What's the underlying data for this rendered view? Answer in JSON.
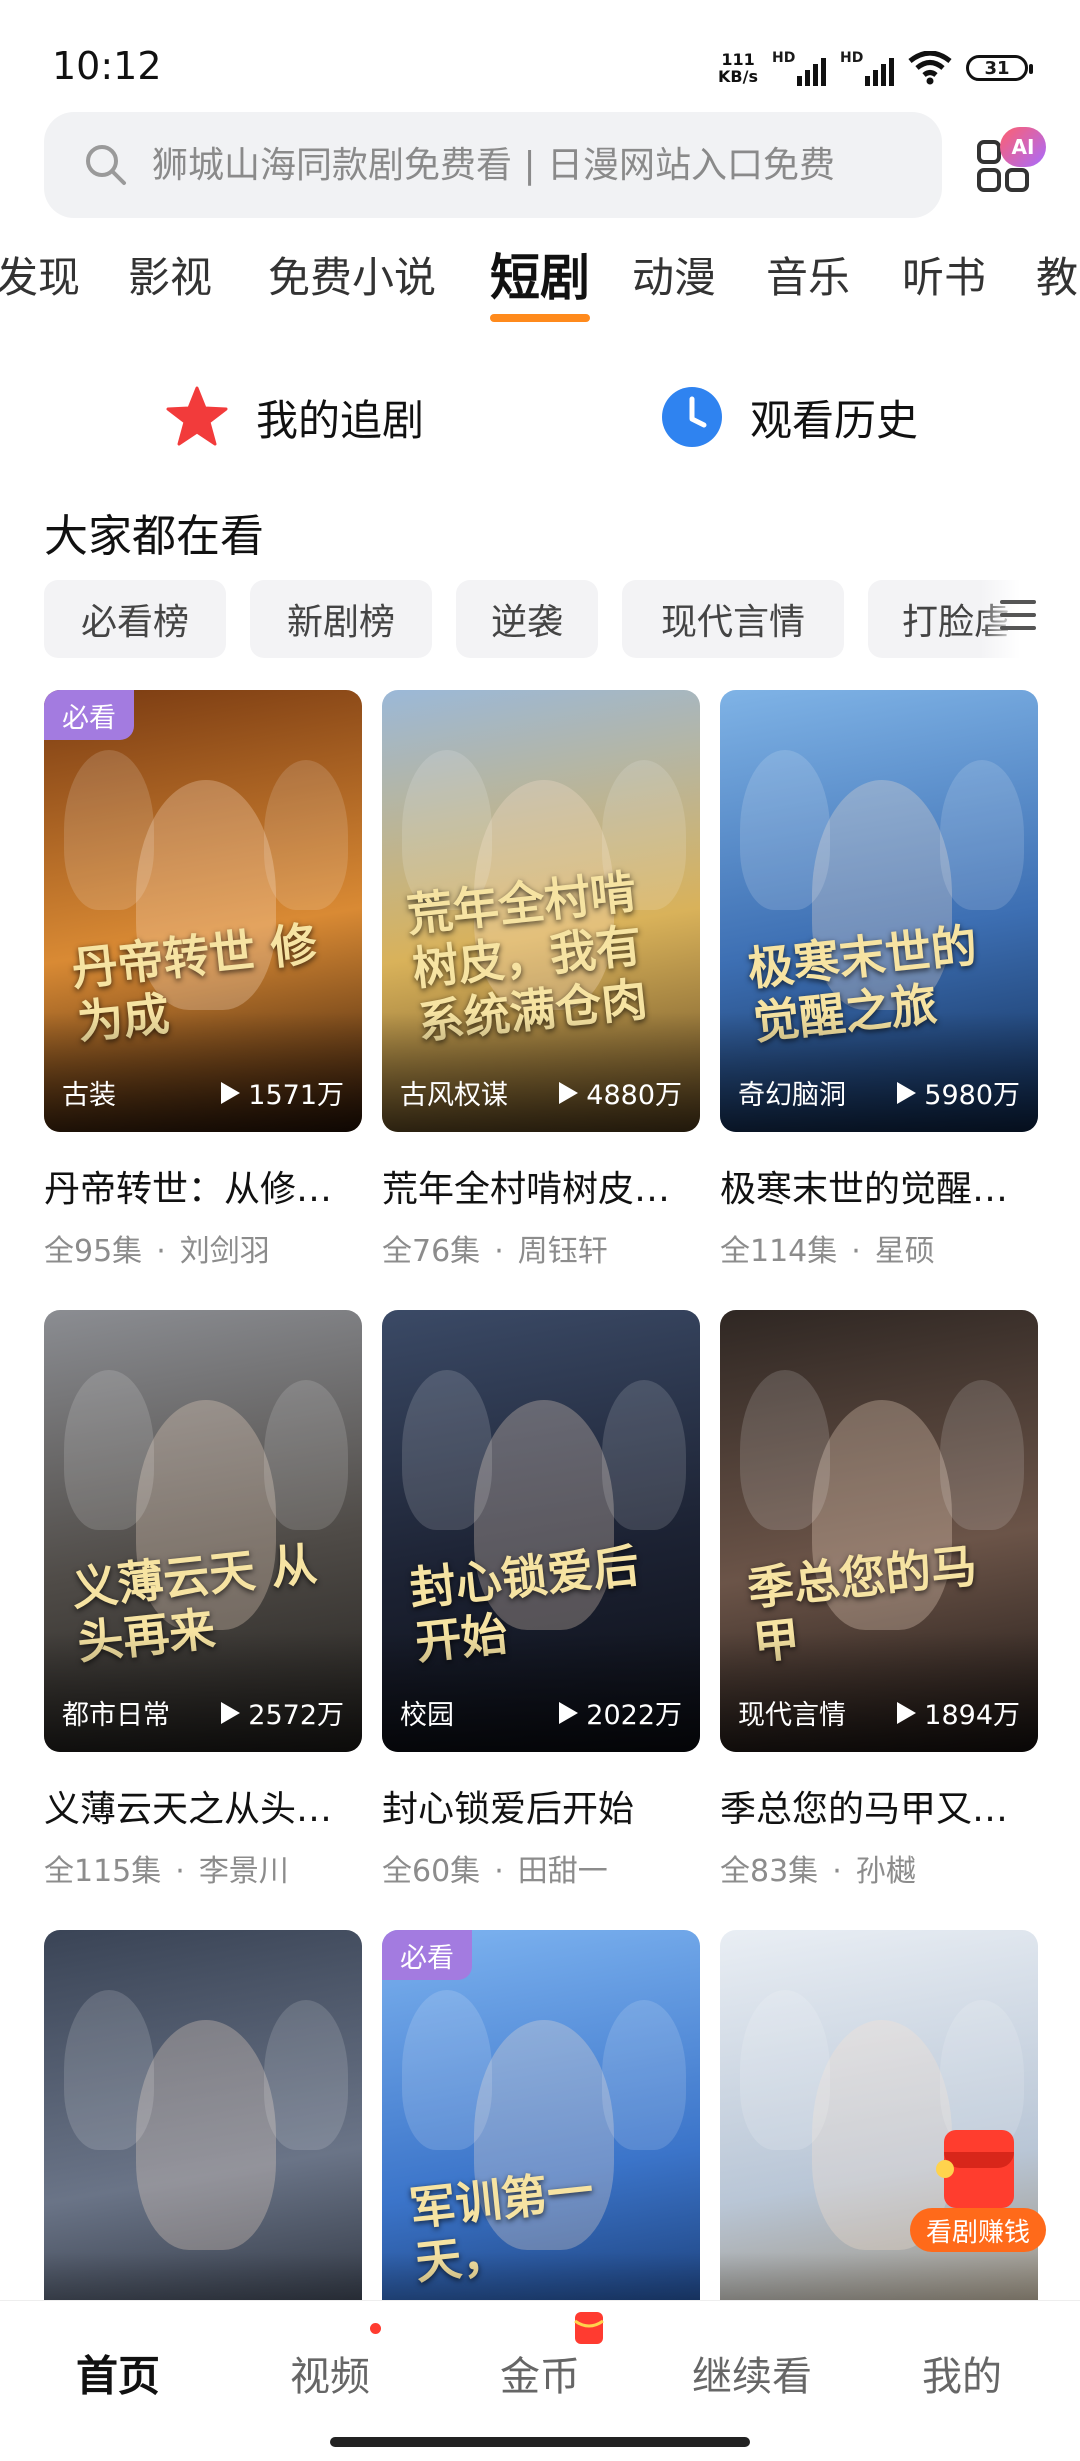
{
  "status_bar": {
    "time": "10:12",
    "speed_value": "111",
    "speed_unit": "KB/s",
    "sig1": "HD",
    "sig2": "HD",
    "battery": "31"
  },
  "search": {
    "placeholder": "狮城山海同款剧免费看 | 日漫网站入口免费",
    "ai_badge": "AI"
  },
  "tabs": [
    "发现",
    "影视",
    "免费小说",
    "短剧",
    "动漫",
    "音乐",
    "听书",
    "教"
  ],
  "active_tab": "短剧",
  "quick_links": {
    "follow": "我的追剧",
    "history": "观看历史"
  },
  "section_title": "大家都在看",
  "chips": [
    "必看榜",
    "新剧榜",
    "逆袭",
    "现代言情",
    "打脸虐"
  ],
  "dramas": [
    {
      "title": "丹帝转世：从修仙成魔开始",
      "episodes": "全95集",
      "actor": "刘剑羽",
      "genre": "古装",
      "plays": "1571万",
      "badge": "必看",
      "poster_text": "丹帝转世 修为成",
      "colors": [
        "#7a3b12",
        "#d98a34",
        "#2a1407"
      ]
    },
    {
      "title": "荒年全村啃树皮，我有系统满仓肉",
      "episodes": "全76集",
      "actor": "周钰轩",
      "genre": "古风权谋",
      "plays": "4880万",
      "badge": "",
      "poster_text": "荒年全村啃树皮，我有系统满仓肉",
      "colors": [
        "#9bb8d8",
        "#d9b25a",
        "#5e4520"
      ]
    },
    {
      "title": "极寒末世的觉醒之旅",
      "episodes": "全114集",
      "actor": "星硕",
      "genre": "奇幻脑洞",
      "plays": "5980万",
      "badge": "",
      "poster_text": "极寒末世的 觉醒之旅",
      "colors": [
        "#7fb3e6",
        "#3d6fb3",
        "#0f2a52"
      ]
    },
    {
      "title": "义薄云天之从头再来",
      "episodes": "全115集",
      "actor": "李景川",
      "genre": "都市日常",
      "plays": "2572万",
      "badge": "",
      "poster_text": "义薄云天 从头再来",
      "colors": [
        "#8b8d92",
        "#4f4b47",
        "#22201d"
      ]
    },
    {
      "title": "封心锁爱后开始",
      "episodes": "全60集",
      "actor": "田甜一",
      "genre": "校园",
      "plays": "2022万",
      "badge": "",
      "poster_text": "封心锁爱后开始",
      "colors": [
        "#3b4a66",
        "#1c2233",
        "#0b0d14"
      ]
    },
    {
      "title": "季总您的马甲又掉了",
      "episodes": "全83集",
      "actor": "孙樾",
      "genre": "现代言情",
      "plays": "1894万",
      "badge": "",
      "poster_text": "季总您的马甲",
      "colors": [
        "#2f2723",
        "#6b5448",
        "#1a1412"
      ]
    },
    {
      "title": "",
      "episodes": "",
      "actor": "",
      "genre": "",
      "plays": "",
      "badge": "",
      "poster_text": "",
      "colors": [
        "#3a4456",
        "#6a7487",
        "#1a1f28"
      ]
    },
    {
      "title": "",
      "episodes": "",
      "actor": "",
      "genre": "",
      "plays": "",
      "badge": "必看",
      "poster_text": "军训第一天，",
      "colors": [
        "#7db3f0",
        "#3b74c9",
        "#102b5a"
      ]
    },
    {
      "title": "",
      "episodes": "",
      "actor": "",
      "genre": "",
      "plays": "",
      "badge": "",
      "poster_text": "",
      "colors": [
        "#e9eef4",
        "#b9c6d6",
        "#8e7a5a"
      ]
    }
  ],
  "float_promo": "看剧赚钱",
  "bottom_nav": [
    "首页",
    "视频",
    "金币",
    "继续看",
    "我的"
  ],
  "colors": {
    "accent": "#ff8a1c",
    "badge": "#a37be0",
    "promo": "#ff6a1a"
  }
}
